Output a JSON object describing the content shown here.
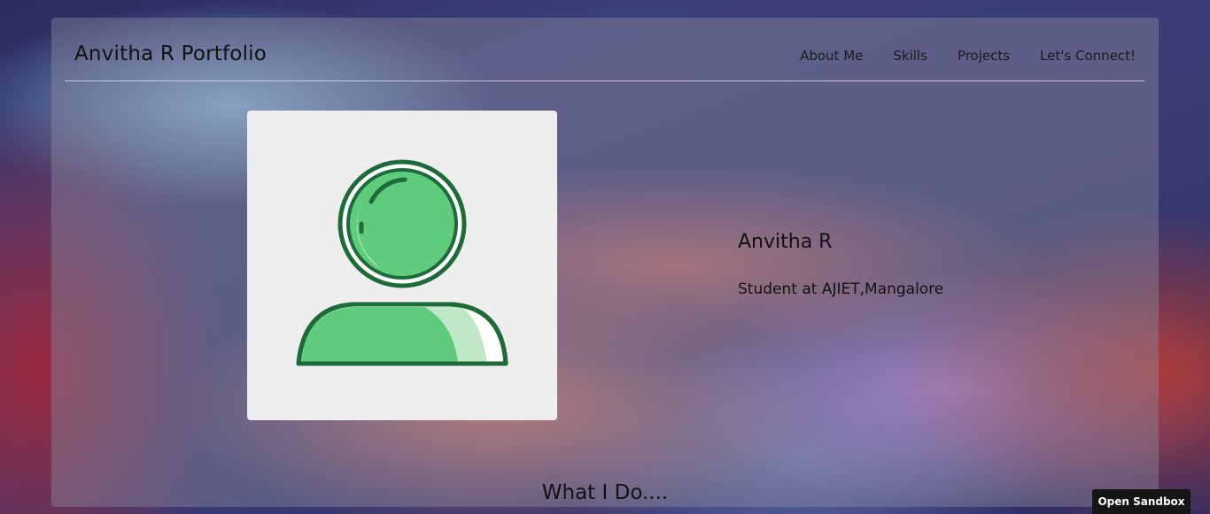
{
  "header": {
    "brand": "Anvitha R Portfolio",
    "nav": [
      "About Me",
      "Skills",
      "Projects",
      "Let's Connect!"
    ]
  },
  "profile": {
    "avatar_icon": "user-avatar-icon",
    "name": "Anvitha R",
    "subtitle": "Student at AJIET,Mangalore"
  },
  "section": {
    "title": "What I Do...."
  },
  "sandbox": {
    "label": "Open Sandbox"
  },
  "colors": {
    "avatar_green": "#5fcb7d",
    "avatar_outline": "#1e6b3a",
    "avatar_highlight": "#bfe8c9"
  }
}
